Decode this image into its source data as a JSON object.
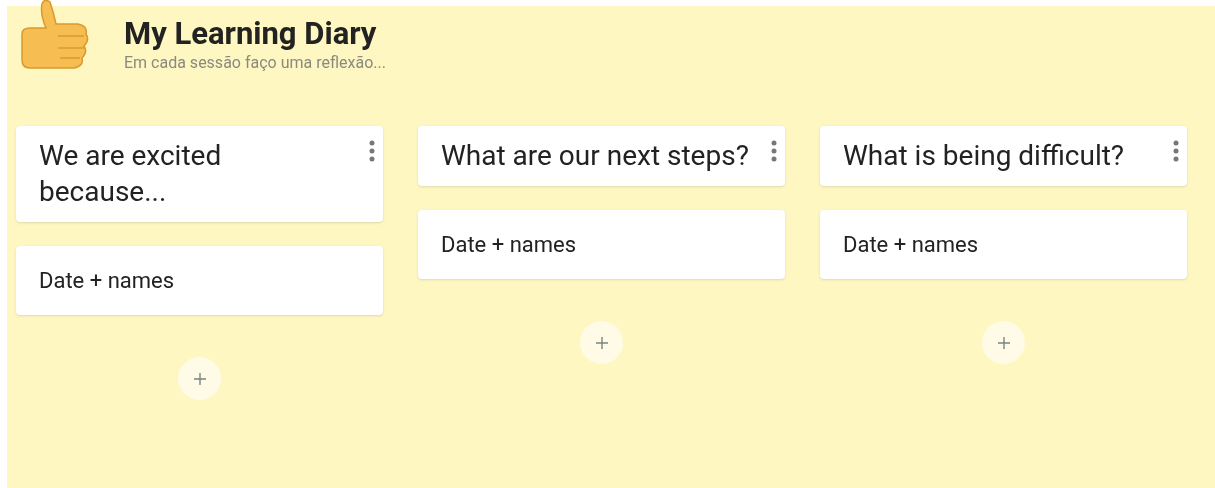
{
  "board": {
    "title": "My Learning Diary",
    "description": "Em cada sessão faço uma reflexão..."
  },
  "columns": [
    {
      "title": "We are excited because...",
      "cards": [
        "Date + names"
      ]
    },
    {
      "title": "What are our next steps?",
      "cards": [
        "Date + names"
      ]
    },
    {
      "title": "What is being difficult?",
      "cards": [
        "Date + names"
      ]
    }
  ]
}
